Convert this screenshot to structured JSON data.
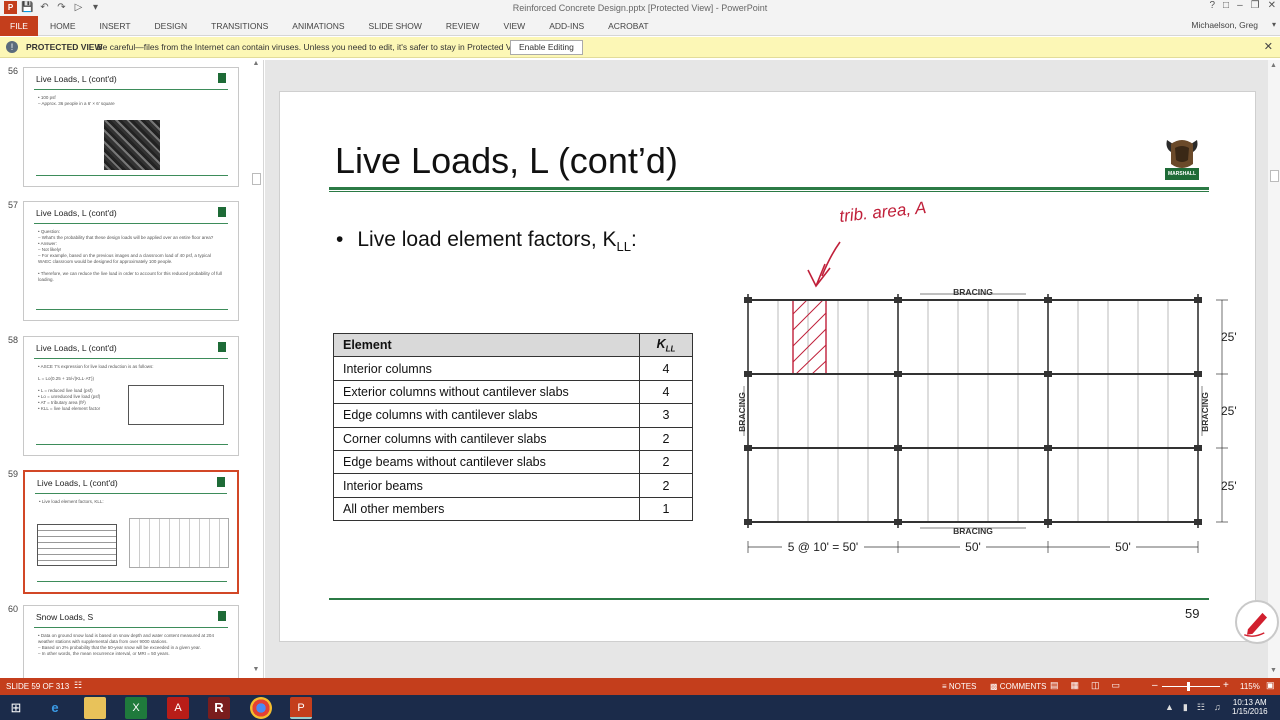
{
  "window": {
    "title": "Reinforced Concrete Design.pptx [Protected View] - PowerPoint",
    "user": "Michaelson, Greg"
  },
  "ribbon": {
    "file_tab": "FILE",
    "tabs": [
      "HOME",
      "INSERT",
      "DESIGN",
      "TRANSITIONS",
      "ANIMATIONS",
      "SLIDE SHOW",
      "REVIEW",
      "VIEW",
      "ADD-INS",
      "ACROBAT"
    ]
  },
  "protected_view": {
    "label": "PROTECTED VIEW",
    "message": "Be careful—files from the Internet can contain viruses. Unless you need to edit, it's safer to stay in Protected View.",
    "enable_button": "Enable Editing"
  },
  "thumbnails": [
    {
      "num": "56",
      "title": "Live Loads, L (cont'd)",
      "text": "• 100 psf\n   – Approx. 36 people in a 6' × 6' square",
      "has_photo": true
    },
    {
      "num": "57",
      "title": "Live Loads, L (cont'd)",
      "text": "• Question:\n   – What's the probability that these design loads will be applied over an entire floor area?\n• Answer:\n   – Not likely!\n   – For example, based on the previous images and a classroom load of 40 psf, a typical WAEC classroom would be designed for approximately 100 people.\n\n• Therefore, we can reduce the live load in order to account for this reduced probability of full loading.",
      "has_photo": false
    },
    {
      "num": "58",
      "title": "Live Loads, L (cont'd)",
      "text": "• ASCE 7's expression for live load reduction is as follows:\n\n      L = Lo(0.25 + 15/√(KLL·AT))\n\n   • L = reduced live load (psf)\n   • Lo = unreduced live load (psf)\n   • AT = tributary area (ft²)\n   • KLL = live load element factor",
      "has_photo": false
    },
    {
      "num": "59",
      "title": "Live Loads, L (cont'd)",
      "text": "• Live load element factors, KLL:",
      "has_photo": false,
      "selected": true
    },
    {
      "num": "60",
      "title": "Snow Loads, S",
      "text": "• Data on ground snow load is based on snow depth and water content measured at 204 weather stations with supplemental data from over 9000 stations.\n   – Based on 2% probability that the 50-year snow will be exceeded in a given year.\n   – In other words, the mean recurrence interval, or MRI = 50 years.",
      "has_photo": false
    }
  ],
  "slide": {
    "title": "Live Loads, L (cont’d)",
    "bullet_main": "Live load element factors, K",
    "bullet_sub": "LL",
    "bullet_tail": ":",
    "number": "59",
    "logo_text": "MARSHALL"
  },
  "table": {
    "header_element": "Element",
    "header_k": "K",
    "header_k_sub": "LL",
    "rows": [
      {
        "element": "Interior columns",
        "k": "4"
      },
      {
        "element": "Exterior columns without cantilever slabs",
        "k": "4"
      },
      {
        "element": "Edge columns with cantilever slabs",
        "k": "3"
      },
      {
        "element": "Corner columns with cantilever slabs",
        "k": "2"
      },
      {
        "element": "Edge beams without cantilever slabs",
        "k": "2"
      },
      {
        "element": "Interior beams",
        "k": "2"
      },
      {
        "element": "All other members",
        "k": "1"
      }
    ]
  },
  "diagram": {
    "handwriting": "trib. area, A",
    "bracing_top": "BRACING",
    "bracing_bottom": "BRACING",
    "bracing_left": "BRACING",
    "bracing_right": "BRACING",
    "dim_25_a": "25'",
    "dim_25_b": "25'",
    "dim_25_c": "25'",
    "dim_bay1": "5 @ 10' = 50'",
    "dim_bay2": "50'",
    "dim_bay3": "50'"
  },
  "status": {
    "slide_count": "SLIDE 59 OF 313",
    "notes": "NOTES",
    "comments": "COMMENTS",
    "zoom": "115%",
    "accent": "#c43e1c"
  },
  "taskbar": {
    "time": "10:13 AM",
    "date": "1/15/2016"
  }
}
